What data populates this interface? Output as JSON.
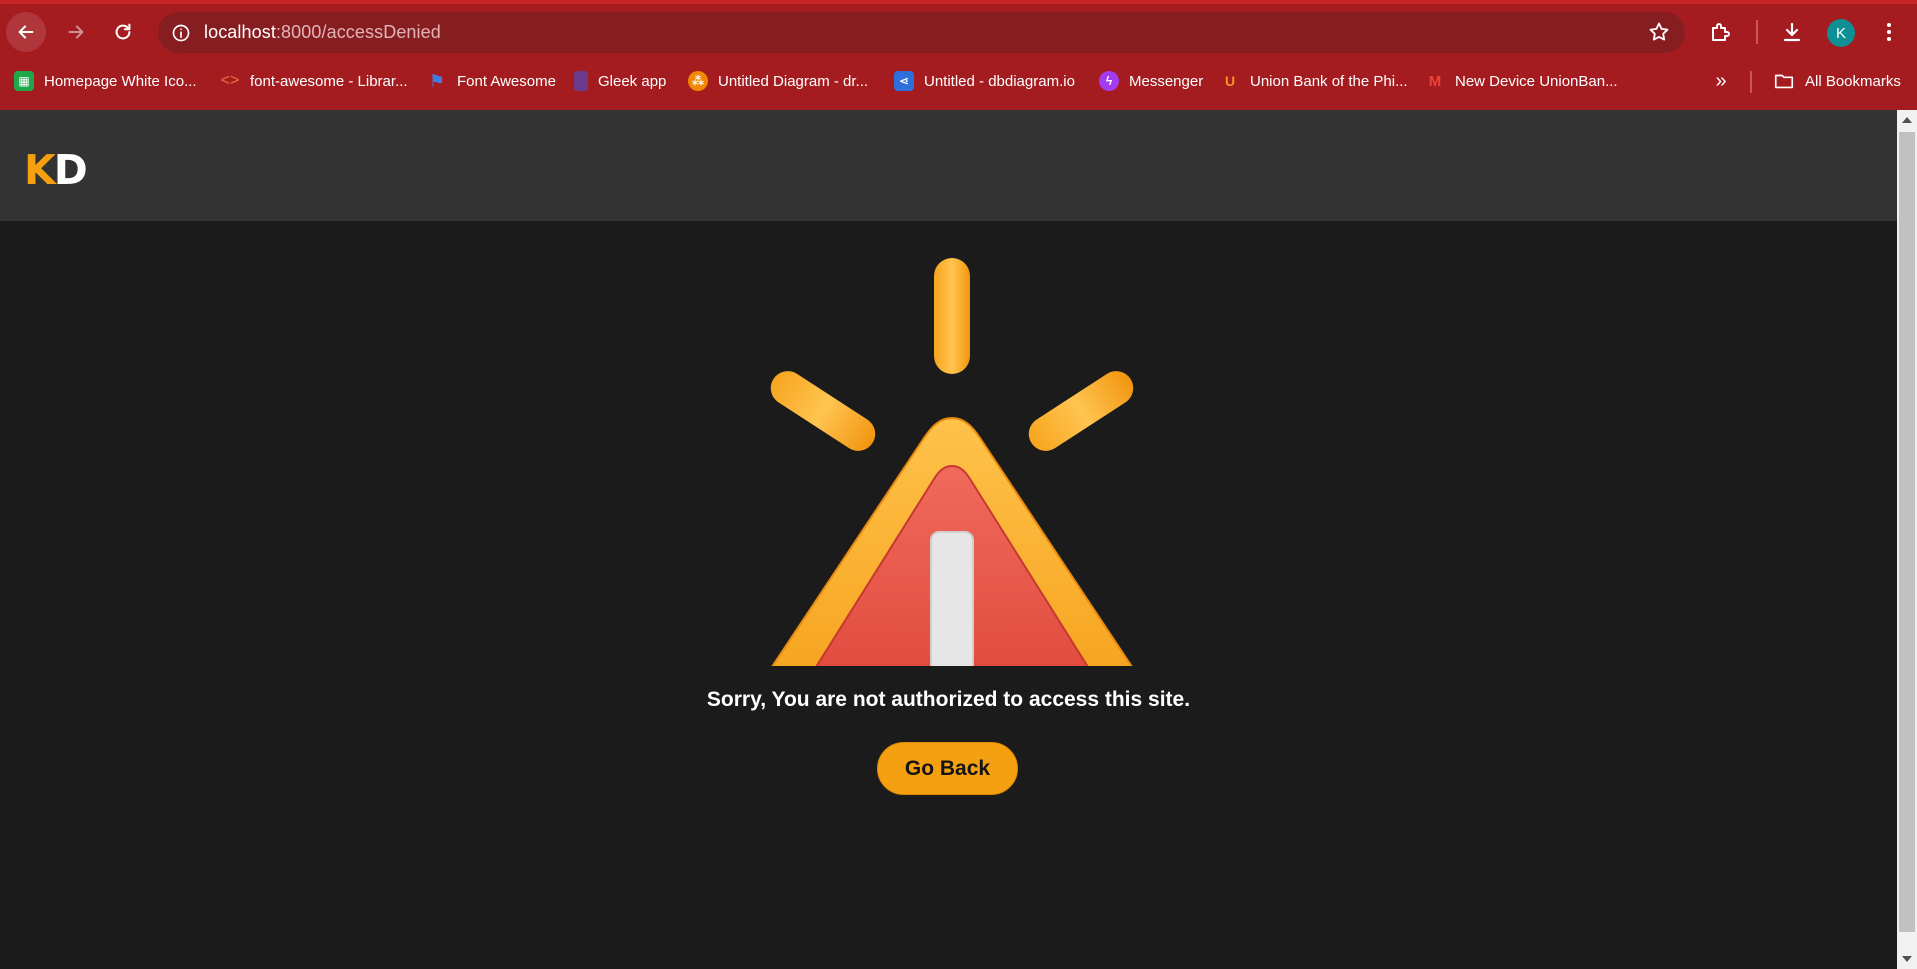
{
  "browser": {
    "url_host": "localhost",
    "url_path": ":8000/accessDenied",
    "profile_initial": "K",
    "bookmarks": [
      {
        "label": "Homepage White Ico...",
        "icon": "green-grid-icon",
        "color": "#1fa94b"
      },
      {
        "label": "font-awesome - Librar...",
        "icon": "code-brackets-icon",
        "color": "#e8743b"
      },
      {
        "label": "Font Awesome",
        "icon": "flag-icon",
        "color": "#3f7ee0"
      },
      {
        "label": "Gleek app",
        "icon": "gleek-icon",
        "color": "#6b3a8c"
      },
      {
        "label": "Untitled Diagram - dr...",
        "icon": "drawio-icon",
        "color": "#f08705"
      },
      {
        "label": "Untitled - dbdiagram.io",
        "icon": "dbdiagram-icon",
        "color": "#2f6fdb"
      },
      {
        "label": "Messenger",
        "icon": "messenger-icon",
        "color": "#a33bf0"
      },
      {
        "label": "Union Bank of the Phi...",
        "icon": "unionbank-icon",
        "color": "#f7931e"
      },
      {
        "label": "New Device UnionBan...",
        "icon": "gmail-icon",
        "color": "#ea4335"
      }
    ],
    "all_bookmarks_label": "All Bookmarks"
  },
  "site": {
    "logo_k": "K",
    "logo_d": "D"
  },
  "main": {
    "message": "Sorry, You are not authorized to access this site.",
    "button_label": "Go Back",
    "icon": "warning-triangle-icon"
  },
  "colors": {
    "accent": "#f5a011",
    "browser_frame": "#a41c20",
    "header_bg": "#333333",
    "page_bg": "#1b1b1b",
    "warning_red": "#e0473f"
  }
}
